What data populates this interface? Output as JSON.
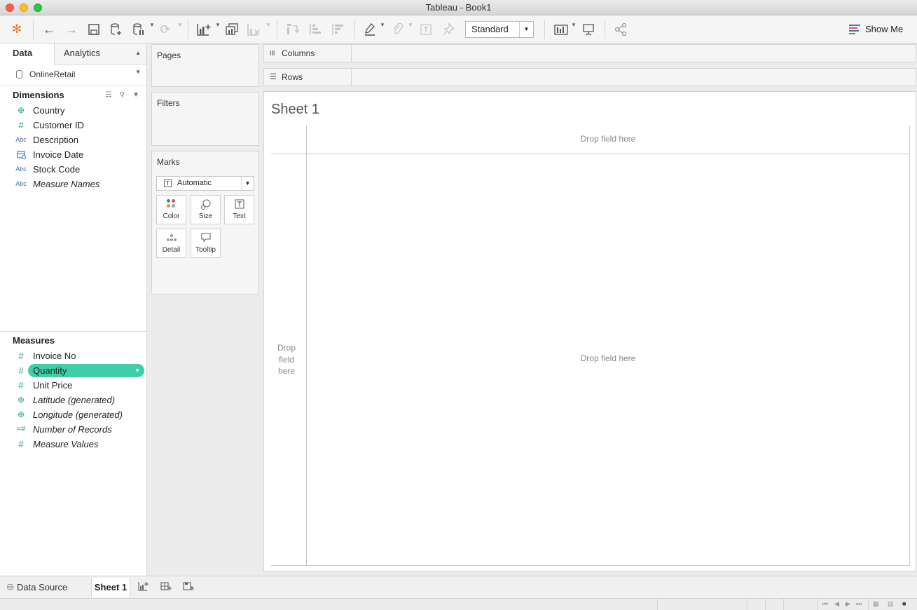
{
  "window": {
    "title": "Tableau - Book1"
  },
  "toolbar": {
    "view_mode": "Standard",
    "show_me_label": "Show Me",
    "show_me_colors": [
      "#4e79a7",
      "#e15759",
      "#59a14f"
    ]
  },
  "data_pane": {
    "tabs": {
      "data": "Data",
      "analytics": "Analytics"
    },
    "datasource": "OnlineRetail",
    "dimensions_header": "Dimensions",
    "dimensions": [
      {
        "icon": "globe",
        "name": "Country"
      },
      {
        "icon": "#",
        "name": "Customer ID"
      },
      {
        "icon": "Abc",
        "name": "Description"
      },
      {
        "icon": "calendar",
        "name": "Invoice Date"
      },
      {
        "icon": "Abc",
        "name": "Stock Code"
      },
      {
        "icon": "Abc",
        "name": "Measure Names"
      }
    ],
    "measures_header": "Measures",
    "measures": [
      {
        "icon": "#",
        "name": "Invoice No"
      },
      {
        "icon": "#",
        "name": "Quantity"
      },
      {
        "icon": "#",
        "name": "Unit Price"
      },
      {
        "icon": "globe",
        "name": "Latitude (generated)"
      },
      {
        "icon": "globe",
        "name": "Longitude (generated)"
      },
      {
        "icon": "=#",
        "name": "Number of Records"
      },
      {
        "icon": "#",
        "name": "Measure Values"
      }
    ]
  },
  "cards": {
    "pages": "Pages",
    "filters": "Filters",
    "marks": "Marks",
    "mark_type": "Automatic",
    "mark_buttons": {
      "color": "Color",
      "size": "Size",
      "text": "Text",
      "detail": "Detail",
      "tooltip": "Tooltip"
    }
  },
  "shelves": {
    "columns": "Columns",
    "rows": "Rows"
  },
  "canvas": {
    "sheet_title": "Sheet 1",
    "drop_top": "Drop field here",
    "drop_center": "Drop field here",
    "drop_left": "Drop field here"
  },
  "sheet_tabs": {
    "data_source": "Data Source",
    "sheet1": "Sheet 1"
  },
  "colors": {
    "selected_pill": "#3fcea8",
    "measure_icon": "#2aa58b",
    "dimension_icon": "#3a6fa8"
  }
}
